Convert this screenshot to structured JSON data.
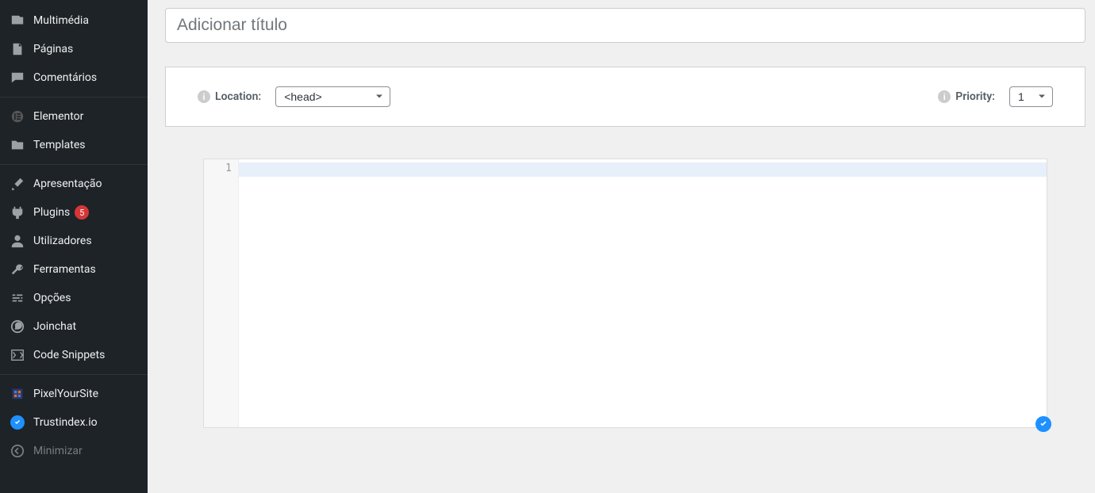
{
  "sidebar": {
    "items": [
      {
        "label": "Multimédia"
      },
      {
        "label": "Páginas"
      },
      {
        "label": "Comentários"
      },
      {
        "label": "Elementor"
      },
      {
        "label": "Templates"
      },
      {
        "label": "Apresentação"
      },
      {
        "label": "Plugins",
        "badge": "5"
      },
      {
        "label": "Utilizadores"
      },
      {
        "label": "Ferramentas"
      },
      {
        "label": "Opções"
      },
      {
        "label": "Joinchat"
      },
      {
        "label": "Code Snippets"
      },
      {
        "label": "PixelYourSite"
      },
      {
        "label": "Trustindex.io"
      },
      {
        "label": "Minimizar"
      }
    ]
  },
  "title": {
    "placeholder": "Adicionar título",
    "value": ""
  },
  "settings": {
    "location": {
      "label": "Location:",
      "value": "<head>"
    },
    "priority": {
      "label": "Priority:",
      "value": "1"
    }
  },
  "editor": {
    "line_number": "1"
  },
  "colors": {
    "accent": "#1e90ff",
    "badge_bg": "#d63638",
    "active_line": "#e7f0fa"
  }
}
